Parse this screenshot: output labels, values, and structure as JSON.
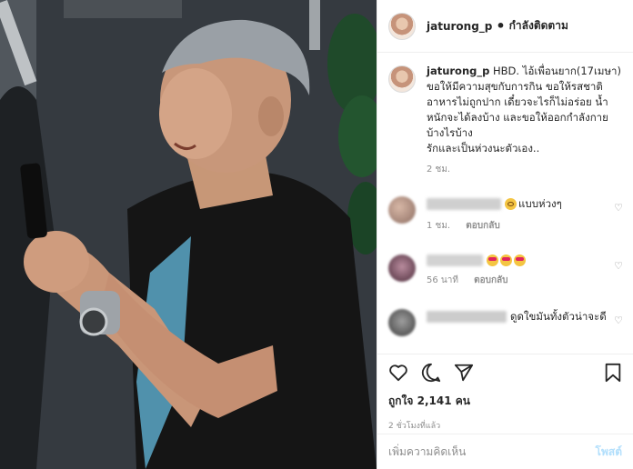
{
  "header": {
    "username": "jaturong_p",
    "separator": "•",
    "follow_label": "กำลังติดตาม"
  },
  "caption": {
    "username": "jaturong_p",
    "text": "HBD. ไอ้เพื่อนยาก(17เมษา) ขอให้มีความสุขกับการกิน ขอให้รสชาติอาหารไม่ถูกปาก เดี๋ยวจะไรก็ไม่อร่อย น้ำหนักจะได้ลงบ้าง และขอให้ออกกำลังกายบ้างไรบ้าง",
    "text2": "รักและเป็นห่วงนะตัวเอง..",
    "time": "2 ชม."
  },
  "comments": [
    {
      "text": "แบบห่วงๆ",
      "emoji": "cry-emoji",
      "time": "1 ชม.",
      "reply": "ตอบกลับ"
    },
    {
      "text": "",
      "emoji": "heart-eyes-emoji",
      "time": "56 นาที",
      "reply": "ตอบกลับ"
    },
    {
      "text": "ดูดใขมันทั้งตัวน่าจะดี",
      "time": "",
      "reply": ""
    }
  ],
  "actions": {
    "icons": [
      "heart-icon",
      "comment-icon",
      "share-icon",
      "bookmark-icon"
    ],
    "likes": "ถูกใจ 2,141 คน",
    "posted": "2 ชั่วโมงที่แล้ว"
  },
  "add_comment": {
    "placeholder": "เพิ่มความคิดเห็น",
    "post_label": "โพสต์"
  },
  "colors": {
    "link_disabled": "#b2dffc",
    "secondary_text": "#8e8e8e",
    "border": "#efefef"
  }
}
